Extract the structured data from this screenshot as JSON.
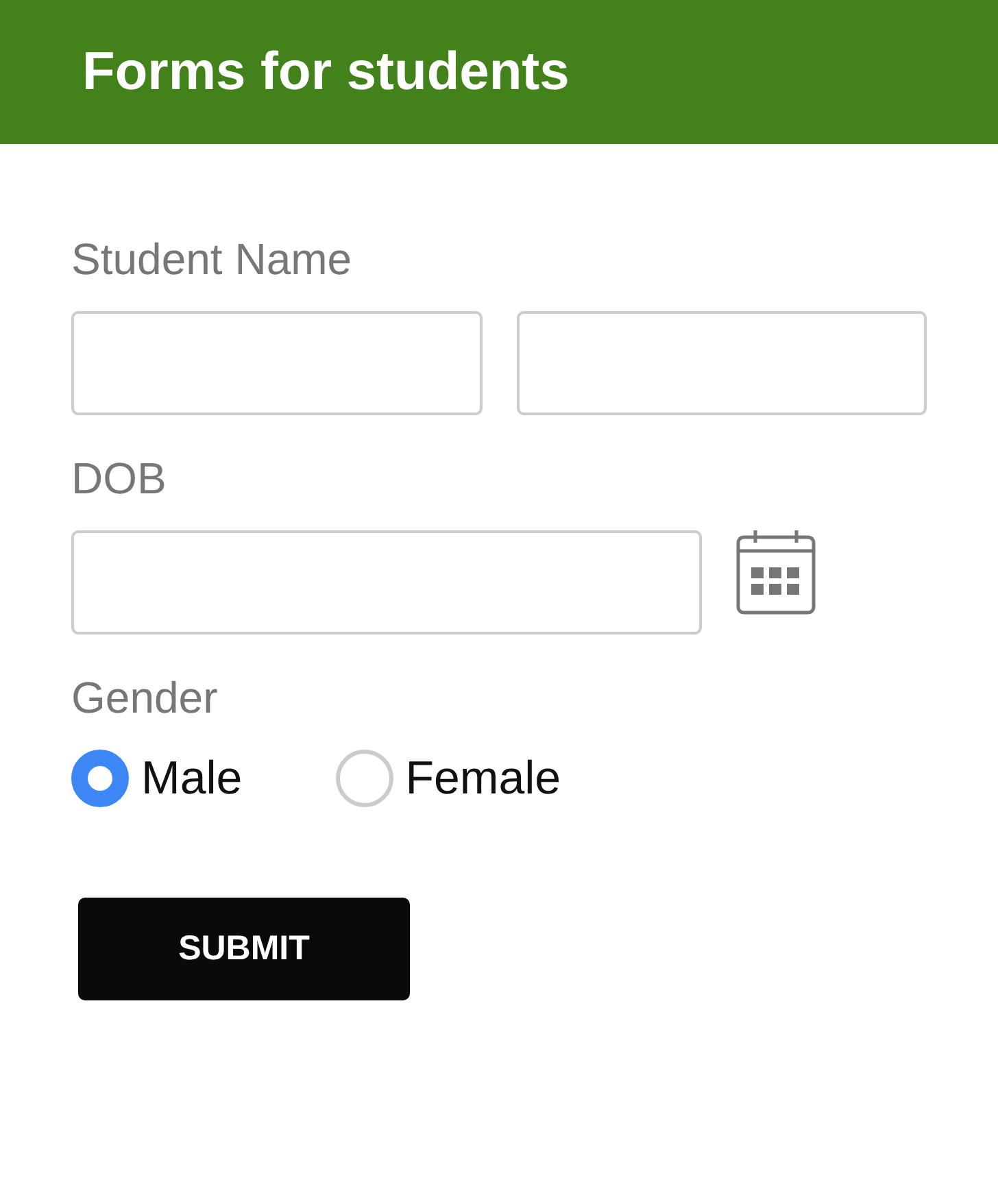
{
  "header": {
    "title": "Forms for students"
  },
  "fields": [
    {
      "kind": "name",
      "label": "Student Name"
    },
    {
      "kind": "date",
      "label": "DOB"
    },
    {
      "kind": "radio",
      "label": "Gender",
      "options": [
        {
          "label": "Male",
          "selected": true
        },
        {
          "label": "Female",
          "selected": false
        }
      ]
    }
  ],
  "submit": {
    "label": "SUBMIT"
  }
}
